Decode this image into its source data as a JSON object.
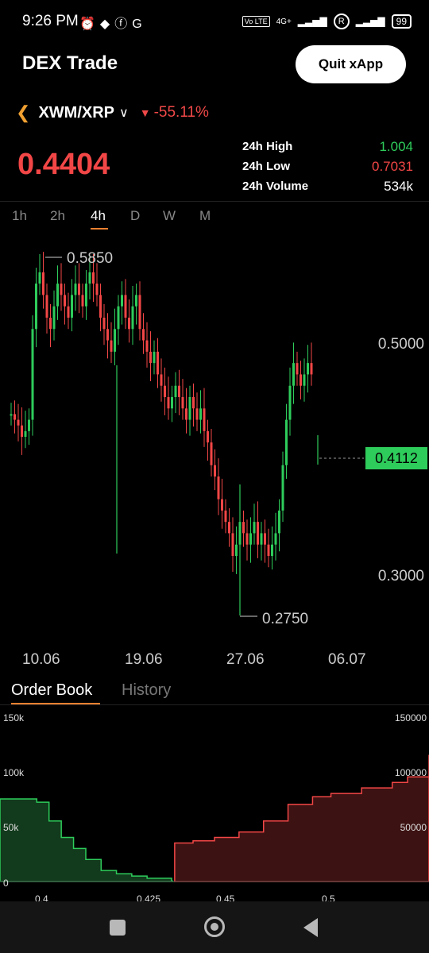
{
  "status_bar": {
    "time": "9:26 PM",
    "left_icons": [
      "alarm-icon",
      "discord-icon",
      "facebook-icon",
      "google-icon"
    ],
    "network_label": "4G+",
    "carrier_badge": "R",
    "battery": "99"
  },
  "header": {
    "title": "DEX Trade",
    "quit_label": "Quit xApp"
  },
  "pair": {
    "name": "XWM/XRP",
    "change": "-55.11%",
    "price": "0.4404"
  },
  "stats": {
    "high_label": "24h High",
    "high_value": "1.004",
    "low_label": "24h Low",
    "low_value": "0.7031",
    "volume_label": "24h Volume",
    "volume_value": "534k"
  },
  "timeframes": [
    "1h",
    "2h",
    "4h",
    "D",
    "W",
    "M"
  ],
  "active_timeframe": "4h",
  "colors": {
    "up": "#2ecc5b",
    "down": "#f24646",
    "accent": "#f08030"
  },
  "chart_data": [
    {
      "type": "candlestick",
      "x_tick_labels": [
        "10.06",
        "19.06",
        "27.06",
        "06.07"
      ],
      "y_tick_labels": [
        "0.5000",
        "0.3000"
      ],
      "ylim": [
        0.25,
        0.6
      ],
      "max_label": "0.5850",
      "min_label": "0.2750",
      "current_price_label": "0.4112",
      "grid": false
    },
    {
      "type": "area",
      "subtype": "depth",
      "x_tick_labels": [
        "0.4",
        "0.425",
        "0.45",
        "0.5"
      ],
      "left_y_labels": [
        "150k",
        "100k",
        "50k",
        "0"
      ],
      "right_y_labels": [
        "150000",
        "100000",
        "50000"
      ],
      "bids": [
        [
          0.4,
          75000
        ],
        [
          0.404,
          72000
        ],
        [
          0.408,
          55000
        ],
        [
          0.412,
          40000
        ],
        [
          0.416,
          30000
        ],
        [
          0.42,
          20000
        ],
        [
          0.425,
          10000
        ],
        [
          0.43,
          7000
        ],
        [
          0.435,
          5000
        ],
        [
          0.44,
          3000
        ],
        [
          0.448,
          1000
        ]
      ],
      "asks": [
        [
          0.449,
          35000
        ],
        [
          0.455,
          37000
        ],
        [
          0.462,
          40000
        ],
        [
          0.47,
          45000
        ],
        [
          0.478,
          55000
        ],
        [
          0.486,
          70000
        ],
        [
          0.494,
          77000
        ],
        [
          0.5,
          80000
        ],
        [
          0.51,
          85000
        ],
        [
          0.52,
          90000
        ],
        [
          0.525,
          95000
        ],
        [
          0.532,
          115000
        ]
      ]
    }
  ],
  "orderbook_tabs": {
    "order_book": "Order Book",
    "history": "History"
  },
  "nav": {
    "recents": "square-icon",
    "home": "circle-icon",
    "back": "triangle-back-icon"
  }
}
